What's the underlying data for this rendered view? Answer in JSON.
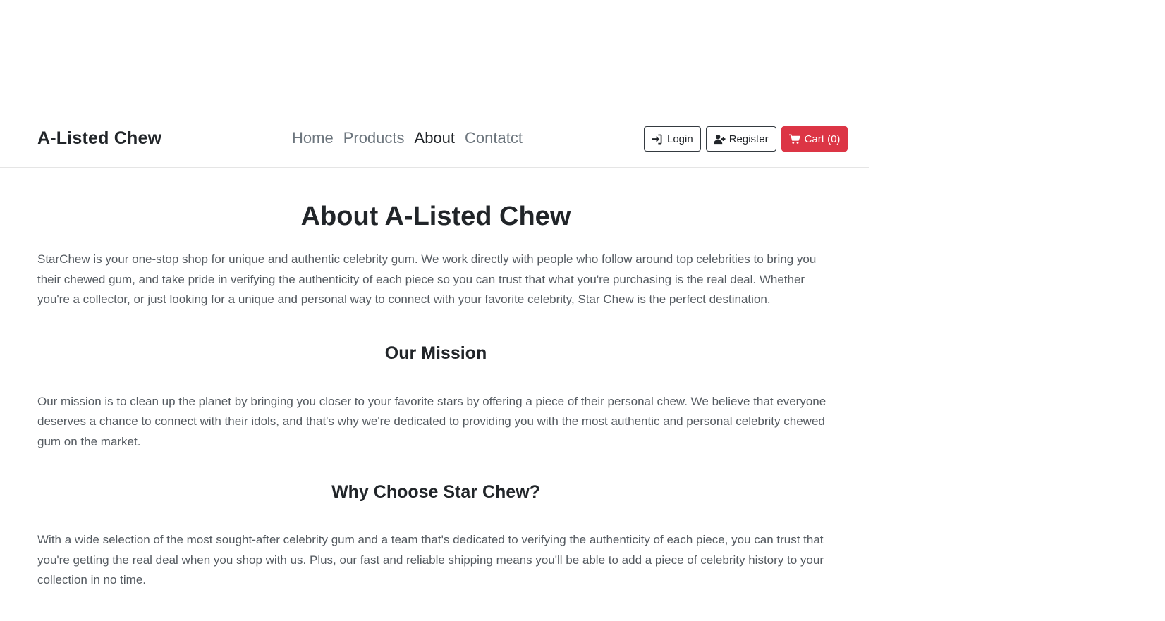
{
  "brand": "A-Listed Chew",
  "nav": {
    "items": [
      {
        "label": "Home",
        "active": false
      },
      {
        "label": "Products",
        "active": false
      },
      {
        "label": "About",
        "active": true
      },
      {
        "label": "Contatct",
        "active": false
      }
    ]
  },
  "actions": {
    "login_label": "Login",
    "register_label": "Register",
    "cart_label": "Cart (0)",
    "cart_color": "#dc3545"
  },
  "icons": {
    "login": "sign-in-icon",
    "register": "user-plus-icon",
    "cart": "shopping-cart-icon"
  },
  "main": {
    "title": "About A-Listed Chew",
    "intro": "StarChew is your one-stop shop for unique and authentic celebrity gum. We work directly with people who follow around top celebrities to bring you their chewed gum, and take pride in verifying the authenticity of each piece so you can trust that what you're purchasing is the real deal. Whether you're a collector, or just looking for a unique and personal way to connect with your favorite celebrity, Star Chew is the perfect destination.",
    "mission_heading": "Our Mission",
    "mission_text": "Our mission is to clean up the planet by bringing you closer to your favorite stars by offering a piece of their personal chew. We believe that everyone deserves a chance to connect with their idols, and that's why we're dedicated to providing you with the most authentic and personal celebrity chewed gum on the market.",
    "why_heading": "Why Choose Star Chew?",
    "why_text": "With a wide selection of the most sought-after celebrity gum and a team that's dedicated to verifying the authenticity of each piece, you can trust that you're getting the real deal when you shop with us. Plus, our fast and reliable shipping means you'll be able to add a piece of celebrity history to your collection in no time."
  }
}
